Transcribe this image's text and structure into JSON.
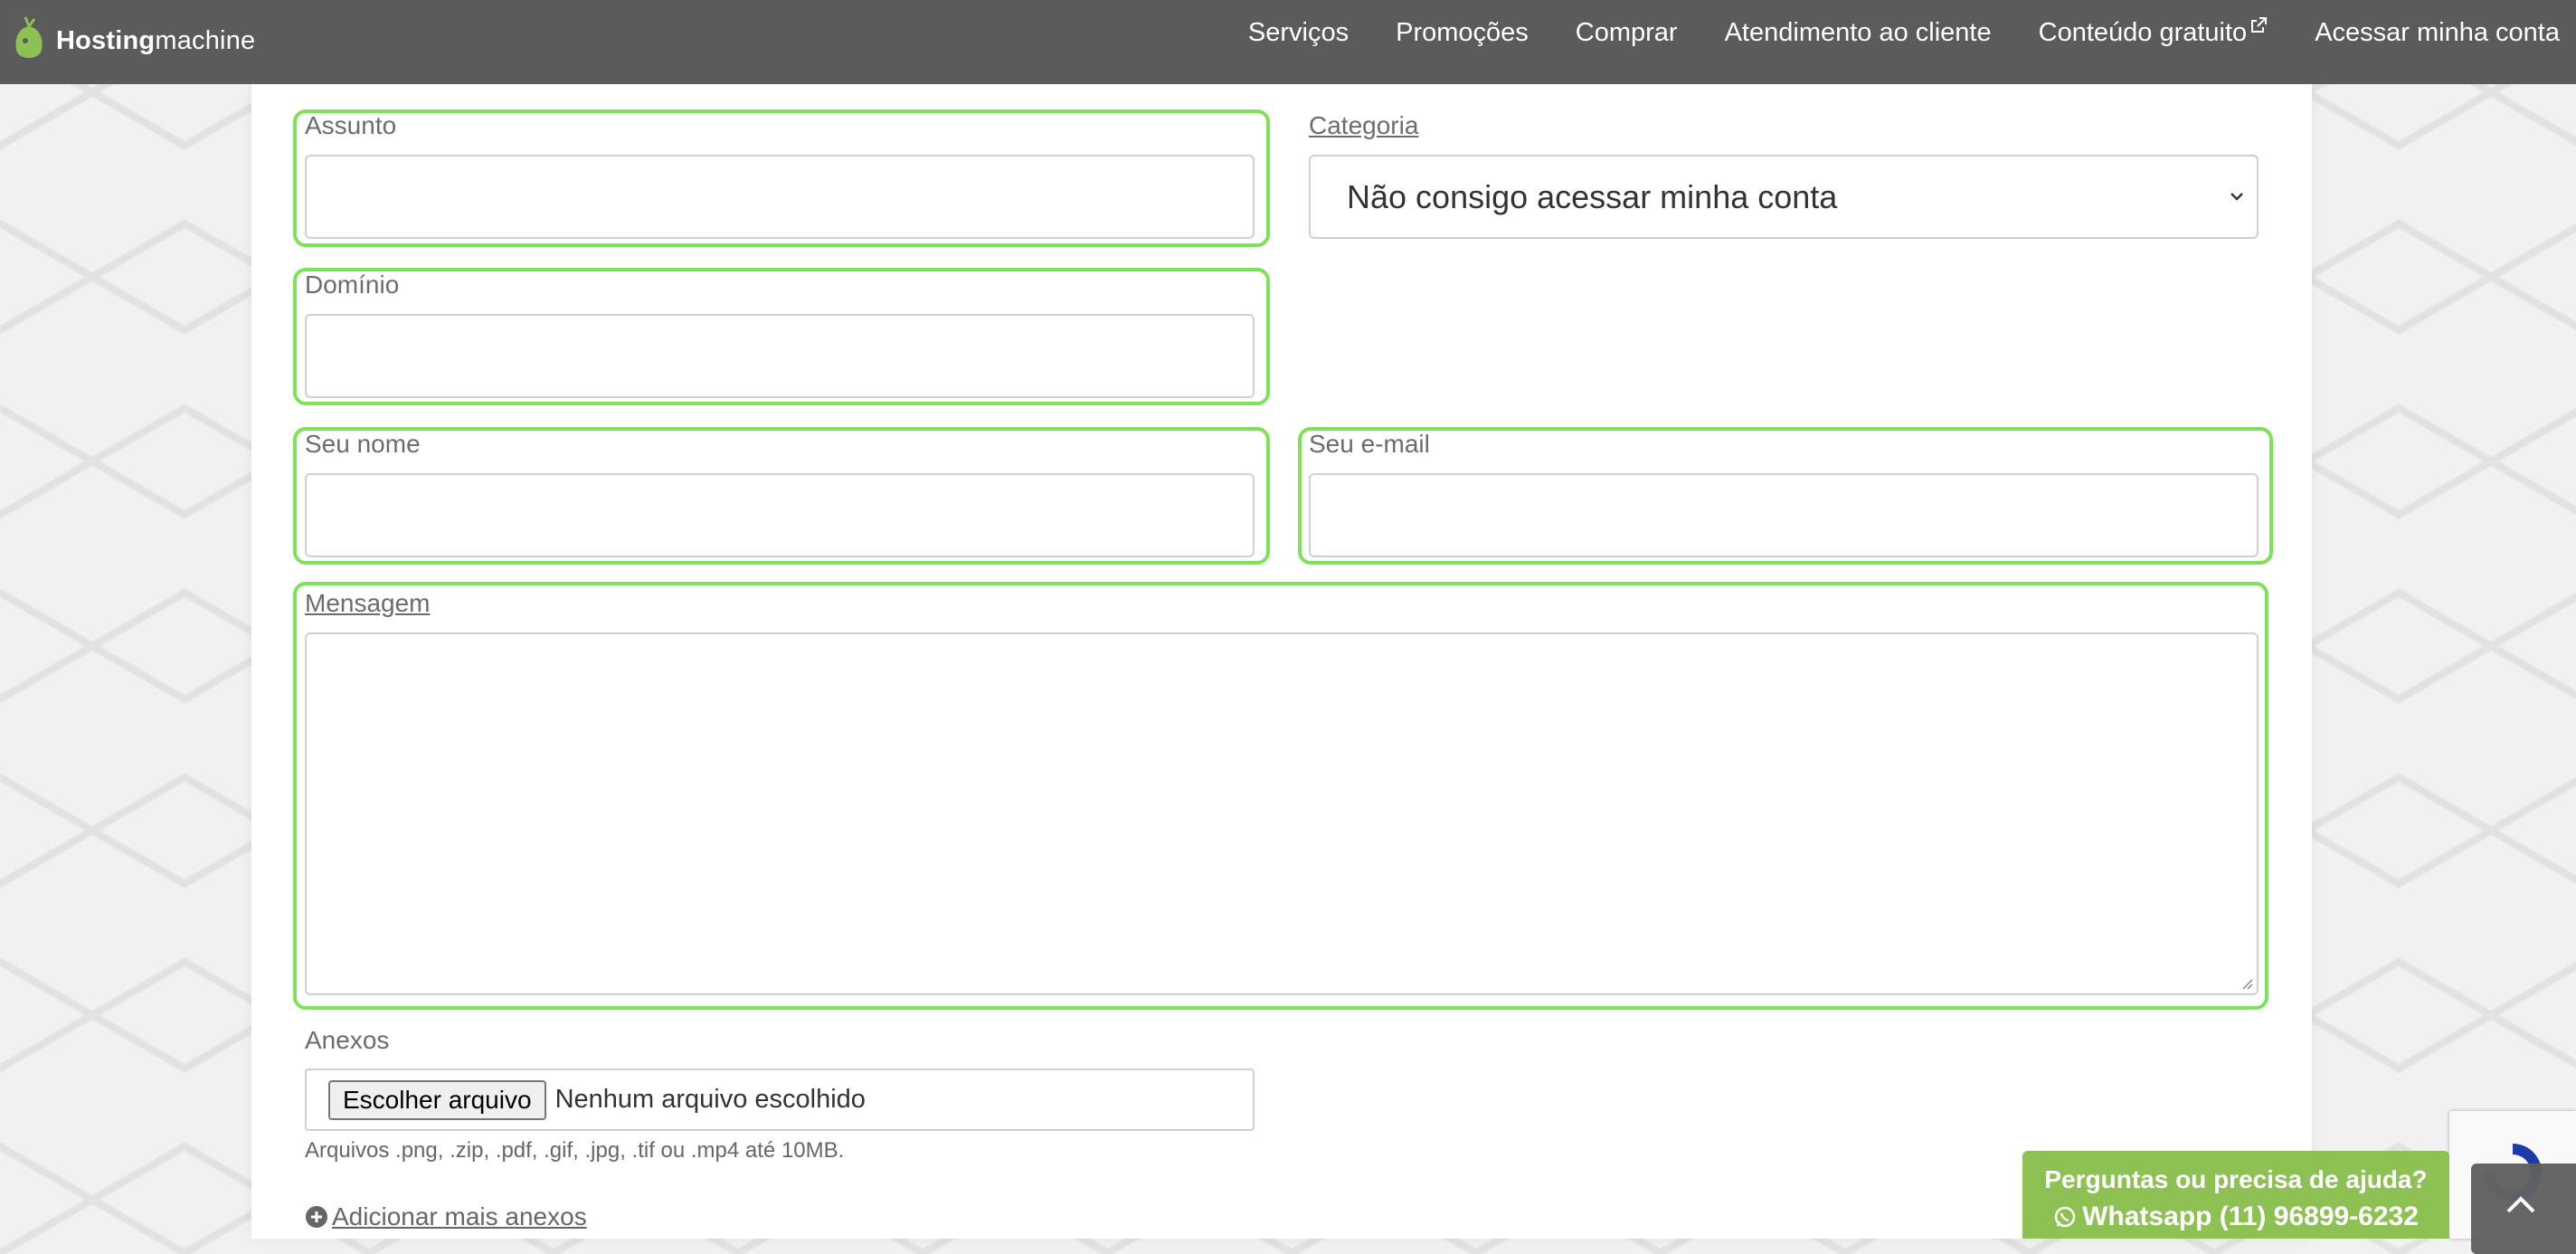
{
  "brand": {
    "bold": "Hosting",
    "light": "machine"
  },
  "nav": {
    "items": [
      "Serviços",
      "Promoções",
      "Comprar",
      "Atendimento ao cliente",
      "Conteúdo gratuito",
      "Acessar minha conta"
    ]
  },
  "form": {
    "assunto": {
      "label": "Assunto",
      "value": ""
    },
    "categoria": {
      "label": "Categoria",
      "selected": "Não consigo acessar minha conta"
    },
    "dominio": {
      "label": "Domínio",
      "value": ""
    },
    "nome": {
      "label": "Seu nome",
      "value": ""
    },
    "email": {
      "label": "Seu e-mail",
      "value": ""
    },
    "mensagem": {
      "label": "Mensagem",
      "value": ""
    },
    "anexos": {
      "label": "Anexos",
      "button": "Escolher arquivo",
      "status": "Nenhum arquivo escolhido",
      "hint": "Arquivos .png, .zip, .pdf, .gif, .jpg, .tif ou .mp4 até 10MB.",
      "add_more": "Adicionar mais anexos"
    }
  },
  "help": {
    "line1": "Perguntas ou precisa de ajuda?",
    "line2": "Whatsapp (11) 96899-6232"
  },
  "colors": {
    "highlight": "#7de256",
    "help_bg": "#8dc153",
    "topbar": "#5b5b5b"
  }
}
